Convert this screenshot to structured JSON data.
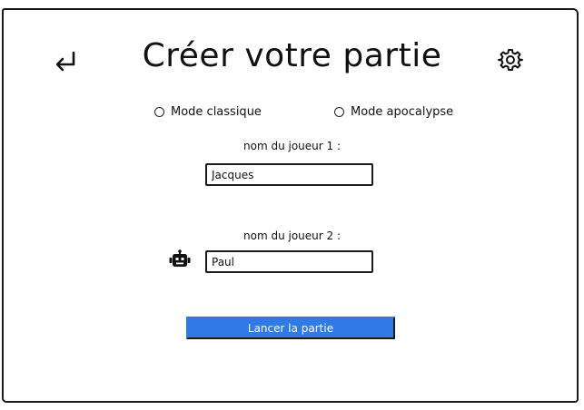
{
  "title": "Créer votre partie",
  "icons": {
    "back": "return-arrow-icon",
    "settings": "gear-icon",
    "bot": "robot-icon"
  },
  "modes": [
    {
      "label": "Mode classique",
      "selected": false
    },
    {
      "label": "Mode apocalypse",
      "selected": false
    }
  ],
  "player1": {
    "label": "nom du joueur 1 :",
    "value": "Jacques"
  },
  "player2": {
    "label": "nom du joueur 2 :",
    "value": "Paul"
  },
  "start_button": {
    "label": "Lancer la partie"
  },
  "colors": {
    "accent": "#2f7ae5",
    "ink": "#1a1a1a"
  }
}
